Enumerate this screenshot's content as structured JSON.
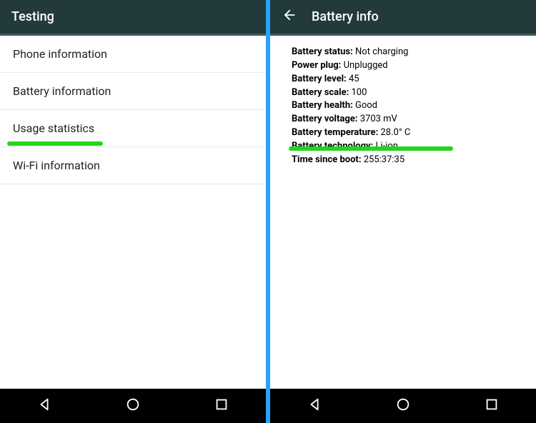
{
  "left": {
    "title": "Testing",
    "items": [
      {
        "label": "Phone information"
      },
      {
        "label": "Battery information"
      },
      {
        "label": "Usage statistics"
      },
      {
        "label": "Wi-Fi information"
      }
    ]
  },
  "right": {
    "title": "Battery info",
    "rows": [
      {
        "label": "Battery status:",
        "value": "Not charging"
      },
      {
        "label": "Power plug:",
        "value": "Unplugged"
      },
      {
        "label": "Battery level:",
        "value": "45"
      },
      {
        "label": "Battery scale:",
        "value": "100"
      },
      {
        "label": "Battery health:",
        "value": "Good"
      },
      {
        "label": "Battery voltage:",
        "value": "3703 mV"
      },
      {
        "label": "Battery temperature:",
        "value": "28.0° C"
      },
      {
        "label": "Battery technology:",
        "value": "Li-ion"
      },
      {
        "label": "Time since boot:",
        "value": "255:37:35"
      }
    ]
  }
}
